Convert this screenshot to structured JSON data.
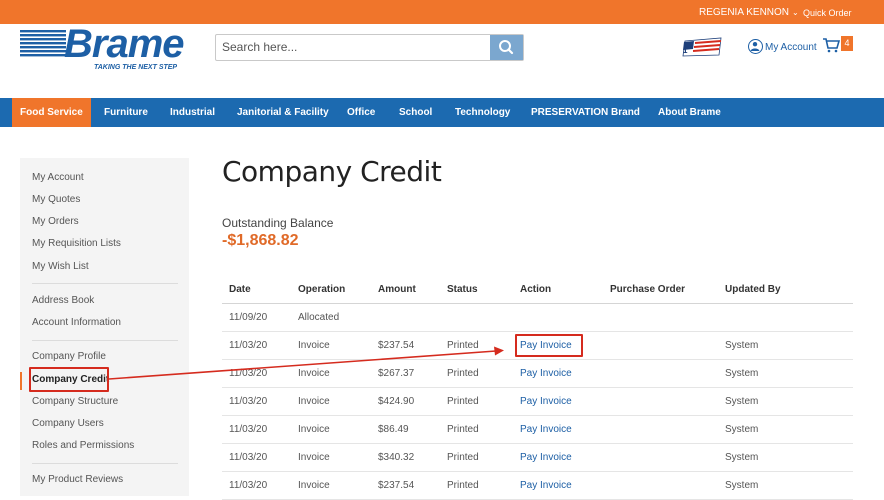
{
  "topbar": {
    "user_name": "REGENIA KENNON",
    "quick_order": "Quick Order"
  },
  "logo": {
    "name": "Brame",
    "tagline": "TAKING THE NEXT STEP"
  },
  "search": {
    "placeholder": "Search here..."
  },
  "header": {
    "my_account": "My Account",
    "cart_count": "4"
  },
  "nav": [
    "Food Service",
    "Furniture",
    "Industrial",
    "Janitorial & Facility",
    "Office",
    "School",
    "Technology",
    "PRESERVATION Brand",
    "About Brame"
  ],
  "sidebar": {
    "group1": [
      "My Account",
      "My Quotes",
      "My Orders",
      "My Requisition Lists",
      "My Wish List"
    ],
    "group2": [
      "Address Book",
      "Account Information"
    ],
    "group3": [
      "Company Profile",
      "Company Credit",
      "Company Structure",
      "Company Users",
      "Roles and Permissions"
    ],
    "group4": [
      "My Product Reviews"
    ]
  },
  "page": {
    "title": "Company Credit",
    "balance_label": "Outstanding Balance",
    "balance_value": "-$1,868.82"
  },
  "table": {
    "headers": [
      "Date",
      "Operation",
      "Amount",
      "Status",
      "Action",
      "Purchase Order",
      "Updated By"
    ],
    "rows": [
      [
        "11/09/20",
        "Allocated",
        "",
        "",
        "",
        "",
        ""
      ],
      [
        "11/03/20",
        "Invoice",
        "$237.54",
        "Printed",
        "Pay Invoice",
        "",
        "System"
      ],
      [
        "11/03/20",
        "Invoice",
        "$267.37",
        "Printed",
        "Pay Invoice",
        "",
        "System"
      ],
      [
        "11/03/20",
        "Invoice",
        "$424.90",
        "Printed",
        "Pay Invoice",
        "",
        "System"
      ],
      [
        "11/03/20",
        "Invoice",
        "$86.49",
        "Printed",
        "Pay Invoice",
        "",
        "System"
      ],
      [
        "11/03/20",
        "Invoice",
        "$340.32",
        "Printed",
        "Pay Invoice",
        "",
        "System"
      ],
      [
        "11/03/20",
        "Invoice",
        "$237.54",
        "Printed",
        "Pay Invoice",
        "",
        "System"
      ]
    ]
  },
  "colors": {
    "orange": "#f0752b",
    "blue": "#1c6ab0",
    "annotation_red": "#d52b1e"
  }
}
